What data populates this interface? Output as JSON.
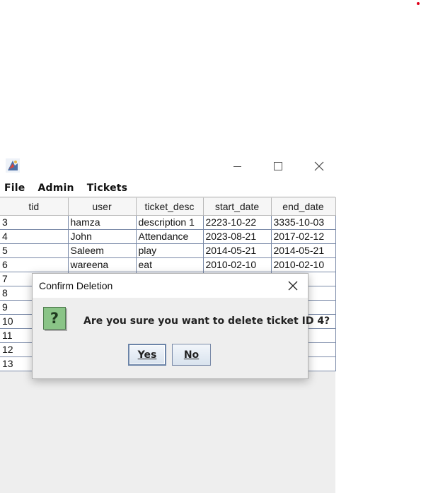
{
  "window": {
    "menu": [
      "File",
      "Admin",
      "Tickets"
    ]
  },
  "table": {
    "columns": [
      "tid",
      "user",
      "ticket_desc",
      "start_date",
      "end_date"
    ],
    "rows": [
      [
        "3",
        "hamza",
        "description 1",
        "2223-10-22",
        "3335-10-03"
      ],
      [
        "4",
        "John",
        "Attendance",
        "2023-08-21",
        "2017-02-12"
      ],
      [
        "5",
        "Saleem",
        "play",
        "2014-05-21",
        "2014-05-21"
      ],
      [
        "6",
        "wareena",
        "eat",
        "2010-02-10",
        "2010-02-10"
      ],
      [
        "7",
        "",
        "",
        "",
        "2-11"
      ],
      [
        "8",
        "",
        "",
        "",
        "3-12"
      ],
      [
        "9",
        "",
        "",
        "",
        "3-13"
      ],
      [
        "10",
        "",
        "",
        "",
        "5-15"
      ],
      [
        "11",
        "",
        "",
        "",
        "3-16"
      ],
      [
        "12",
        "",
        "",
        "",
        "3-16"
      ],
      [
        "13",
        "",
        "",
        "",
        "7-17"
      ]
    ]
  },
  "dialog": {
    "title": "Confirm Deletion",
    "message": "Are you sure you want to delete ticket ID 4?",
    "icon": "question-icon",
    "yes_label": "Yes",
    "no_label": "No"
  },
  "colors": {
    "dialog_bg": "#eeeeee",
    "icon_green": "#8ac487",
    "status_dot": "#e0001a"
  }
}
